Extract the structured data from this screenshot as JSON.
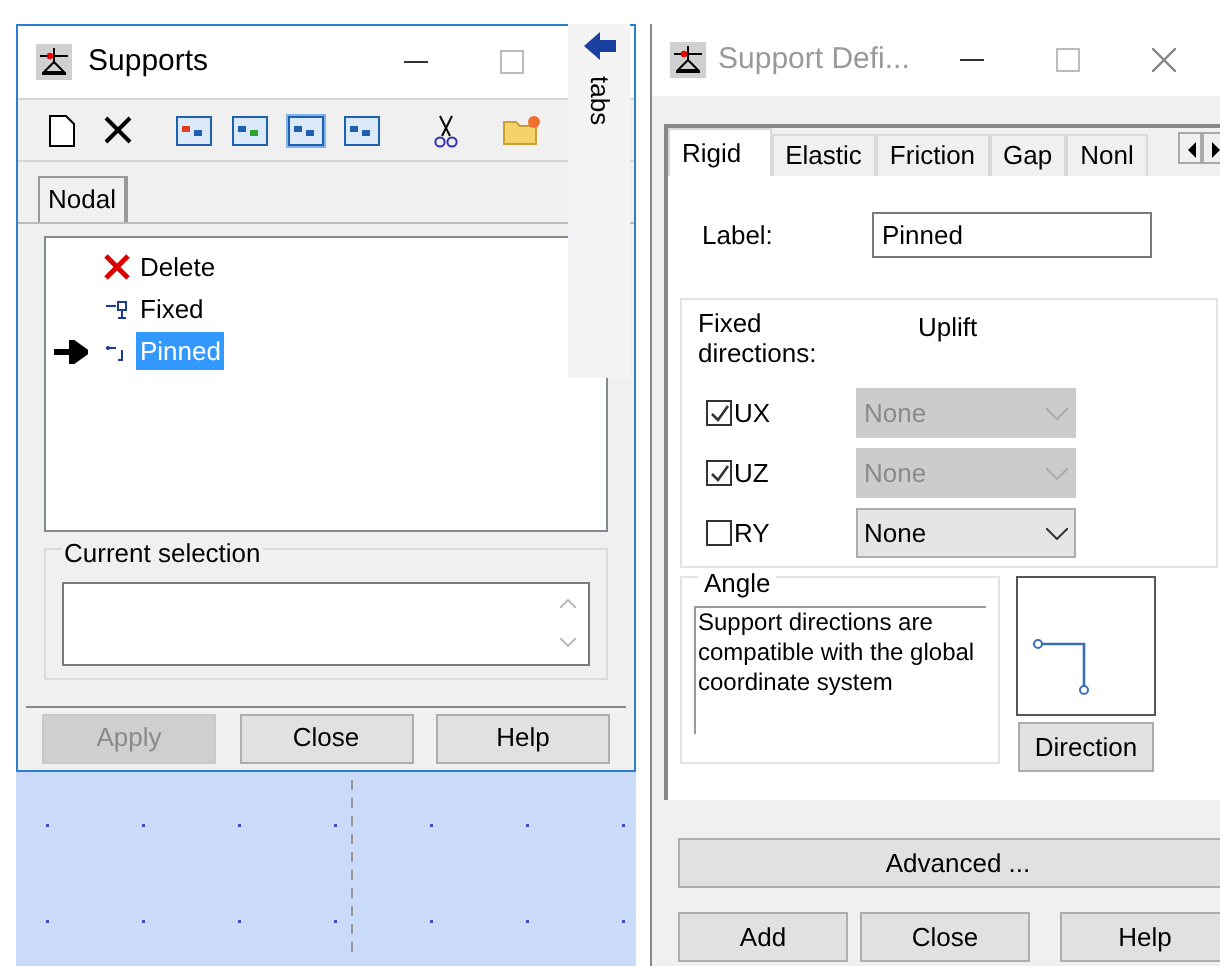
{
  "supports_window": {
    "title": "Supports",
    "tabs": [
      {
        "label": "Nodal",
        "selected": true
      }
    ],
    "items": [
      {
        "kind": "delete",
        "label": "Delete",
        "selected": false,
        "current": false
      },
      {
        "kind": "fixed",
        "label": "Fixed",
        "selected": false,
        "current": false
      },
      {
        "kind": "pinned",
        "label": "Pinned",
        "selected": true,
        "current": true
      }
    ],
    "selection_group": "Current selection",
    "buttons": [
      {
        "label": "Apply",
        "disabled": true
      },
      {
        "label": "Close",
        "disabled": false
      },
      {
        "label": "Help",
        "disabled": false
      }
    ]
  },
  "side_tab": {
    "label": "tabs"
  },
  "definition_window": {
    "title": "Support Defi...",
    "tabs": [
      {
        "label": "Rigid",
        "selected": true
      },
      {
        "label": "Elastic",
        "selected": false
      },
      {
        "label": "Friction",
        "selected": false
      },
      {
        "label": "Gap",
        "selected": false
      },
      {
        "label": "Nonl",
        "selected": false
      }
    ],
    "label_field": {
      "label": "Label:",
      "value": "Pinned"
    },
    "fixed_label": "Fixed directions:",
    "uplift_label": "Uplift",
    "directions": [
      {
        "label": "UX",
        "checked": true,
        "uplift": "None",
        "disabled": true
      },
      {
        "label": "UZ",
        "checked": true,
        "uplift": "None",
        "disabled": true
      },
      {
        "label": "RY",
        "checked": false,
        "uplift": "None",
        "disabled": false
      }
    ],
    "angle": {
      "title": "Angle",
      "text": "Support directions are compatible with the global coordinate system"
    },
    "direction_button": "Direction",
    "advanced_button": "Advanced ...",
    "buttons": [
      "Add",
      "Close",
      "Help"
    ]
  }
}
